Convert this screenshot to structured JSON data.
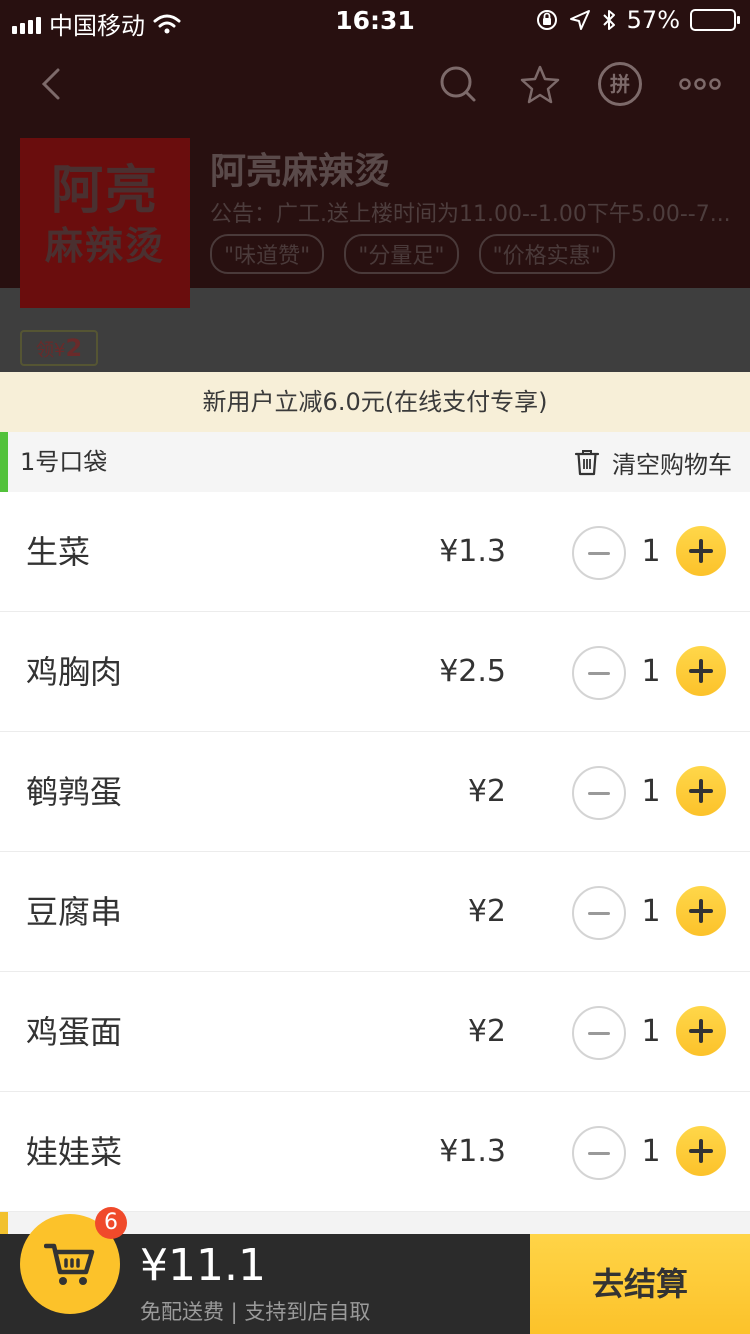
{
  "status_bar": {
    "carrier": "中国移动",
    "time": "16:31",
    "battery_percent": "57%",
    "battery_level": 0.57
  },
  "header": {
    "icons": [
      "back-icon",
      "search-icon",
      "star-icon",
      "pin-icon",
      "more-icon"
    ],
    "pin_label": "拼"
  },
  "shop": {
    "logo_line1": "阿亮",
    "logo_line2": "麻辣烫",
    "name": "阿亮麻辣烫",
    "notice": "公告：广工.送上楼时间为11.00--1.00下午5.00--7...",
    "tags": [
      "\"味道赞\"",
      "\"分量足\"",
      "\"价格实惠\""
    ],
    "coupon_prefix": "领¥",
    "coupon_amount": "2"
  },
  "promo": {
    "text": "新用户立减6.0元(在线支付专享)"
  },
  "bag": {
    "title": "1号口袋",
    "clear_label": "清空购物车"
  },
  "items": [
    {
      "name": "生菜",
      "price": "¥1.3",
      "qty": "1"
    },
    {
      "name": "鸡胸肉",
      "price": "¥2.5",
      "qty": "1"
    },
    {
      "name": "鹌鹑蛋",
      "price": "¥2",
      "qty": "1"
    },
    {
      "name": "豆腐串",
      "price": "¥2",
      "qty": "1"
    },
    {
      "name": "鸡蛋面",
      "price": "¥2",
      "qty": "1"
    },
    {
      "name": "娃娃菜",
      "price": "¥1.3",
      "qty": "1"
    }
  ],
  "bottom": {
    "badge_count": "6",
    "total": "¥11.1",
    "shipping_note": "免配送费 | 支持到店自取",
    "checkout_label": "去结算"
  },
  "colors": {
    "accent": "#fcc22a",
    "bag_bar": "#53c23b",
    "badge": "#f04a2b",
    "promo_bg": "#f7efd8"
  }
}
